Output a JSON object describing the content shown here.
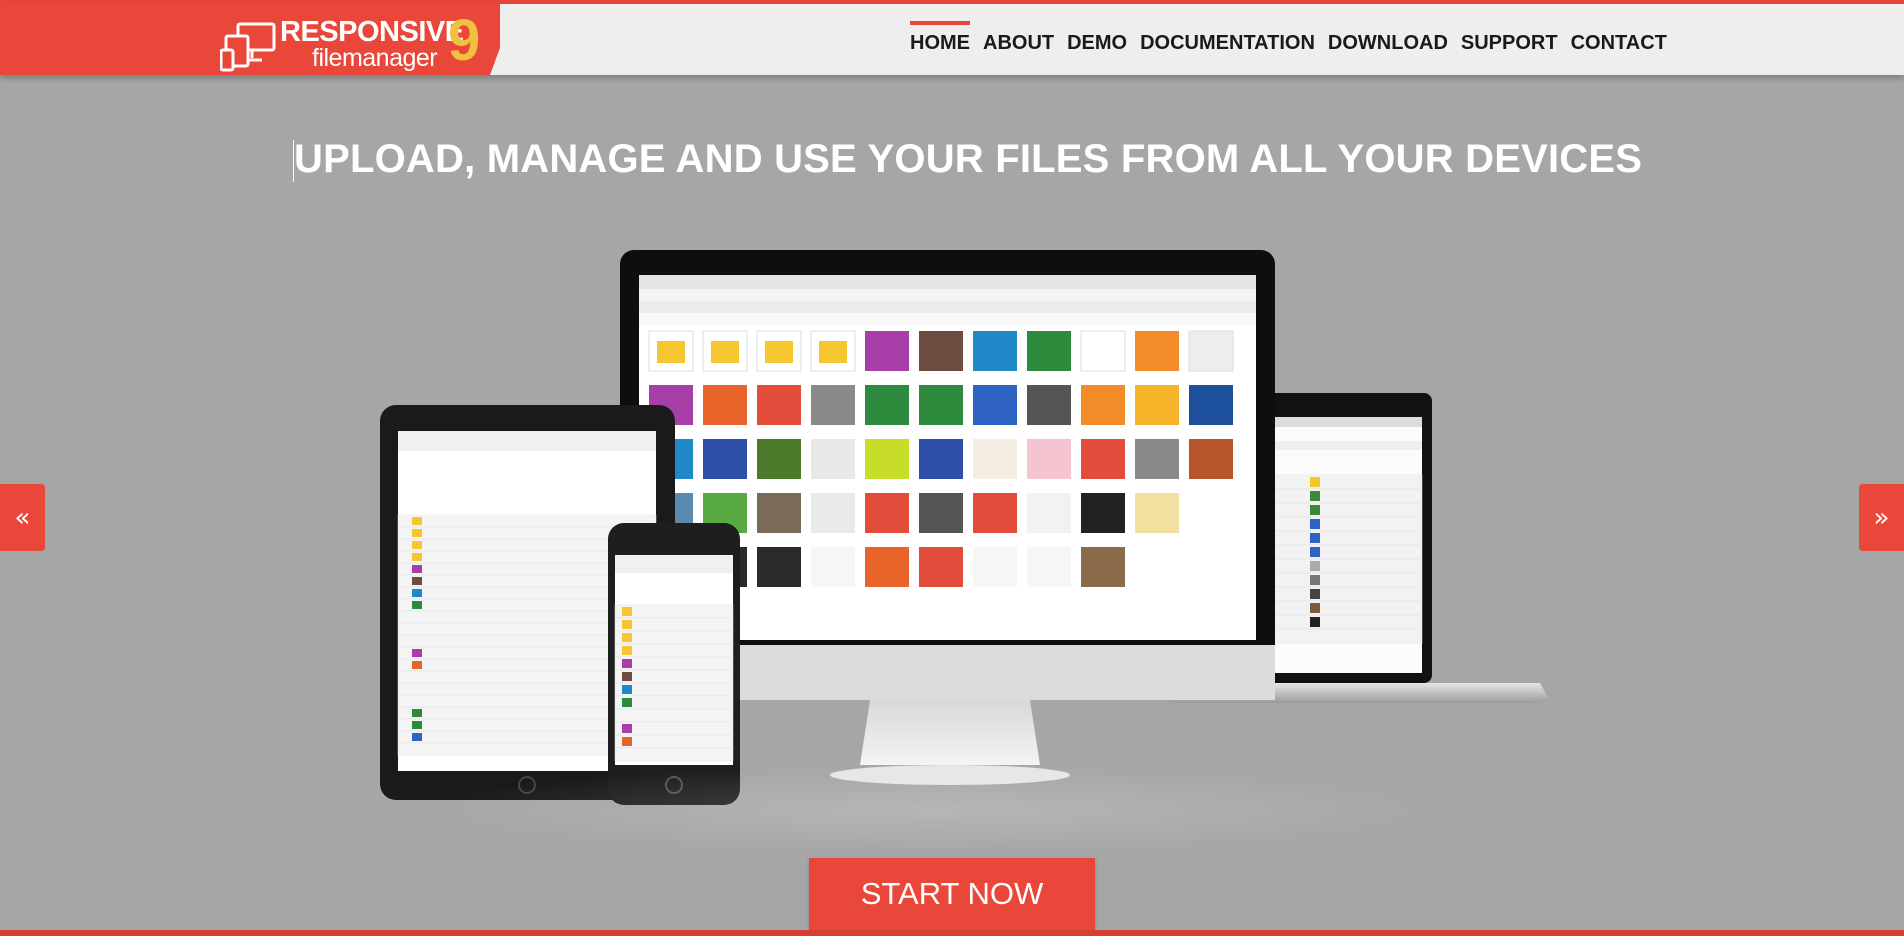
{
  "header": {
    "logo_line1": "RESPONSIVE",
    "logo_line2": "filemanager",
    "logo_version": "9",
    "nav": [
      {
        "label": "HOME"
      },
      {
        "label": "ABOUT"
      },
      {
        "label": "DEMO"
      },
      {
        "label": "DOCUMENTATION"
      },
      {
        "label": "DOWNLOAD"
      },
      {
        "label": "SUPPORT"
      },
      {
        "label": "CONTACT"
      }
    ]
  },
  "hero": {
    "headline": "UPLOAD, MANAGE AND USE YOUR FILES FROM ALL YOUR DEVICES",
    "prev_symbol": "«",
    "next_symbol": "»",
    "cta_label": "START NOW"
  },
  "colors": {
    "brand_red": "#e8473a",
    "background": "#a6a6a6",
    "header_bg": "#eeeeee"
  },
  "icons": [
    "devices-logo-icon",
    "prev-arrow-icon",
    "next-arrow-icon"
  ]
}
